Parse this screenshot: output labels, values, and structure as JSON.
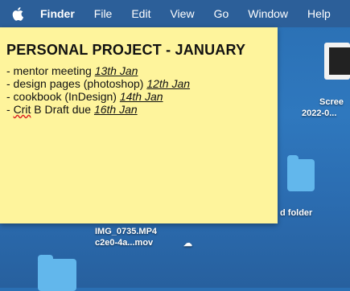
{
  "menubar": {
    "app": "Finder",
    "items": [
      "File",
      "Edit",
      "View",
      "Go",
      "Window",
      "Help"
    ]
  },
  "sticky": {
    "title": "PERSONAL PROJECT - JANUARY",
    "items": [
      {
        "text": "- mentor meeting ",
        "date": "13th Jan"
      },
      {
        "text": "- design pages (photoshop) ",
        "date": "12th Jan"
      },
      {
        "text": "- cookbook (InDesign) ",
        "date": "14th Jan"
      },
      {
        "prefix": "- ",
        "spell": "Crit",
        "text": " B Draft due ",
        "date": "16th Jan"
      }
    ]
  },
  "desktop": {
    "screenshot_label_1": "Scree",
    "screenshot_label_2": "2022-0...",
    "folder_label": "d folder",
    "file_label_1": "IMG_0735.MP4",
    "file_label_2": "c2e0-4a...mov"
  },
  "colors": {
    "menubar": "#2c5f99",
    "sticky": "#fef49c",
    "folder": "#62b7ec"
  }
}
